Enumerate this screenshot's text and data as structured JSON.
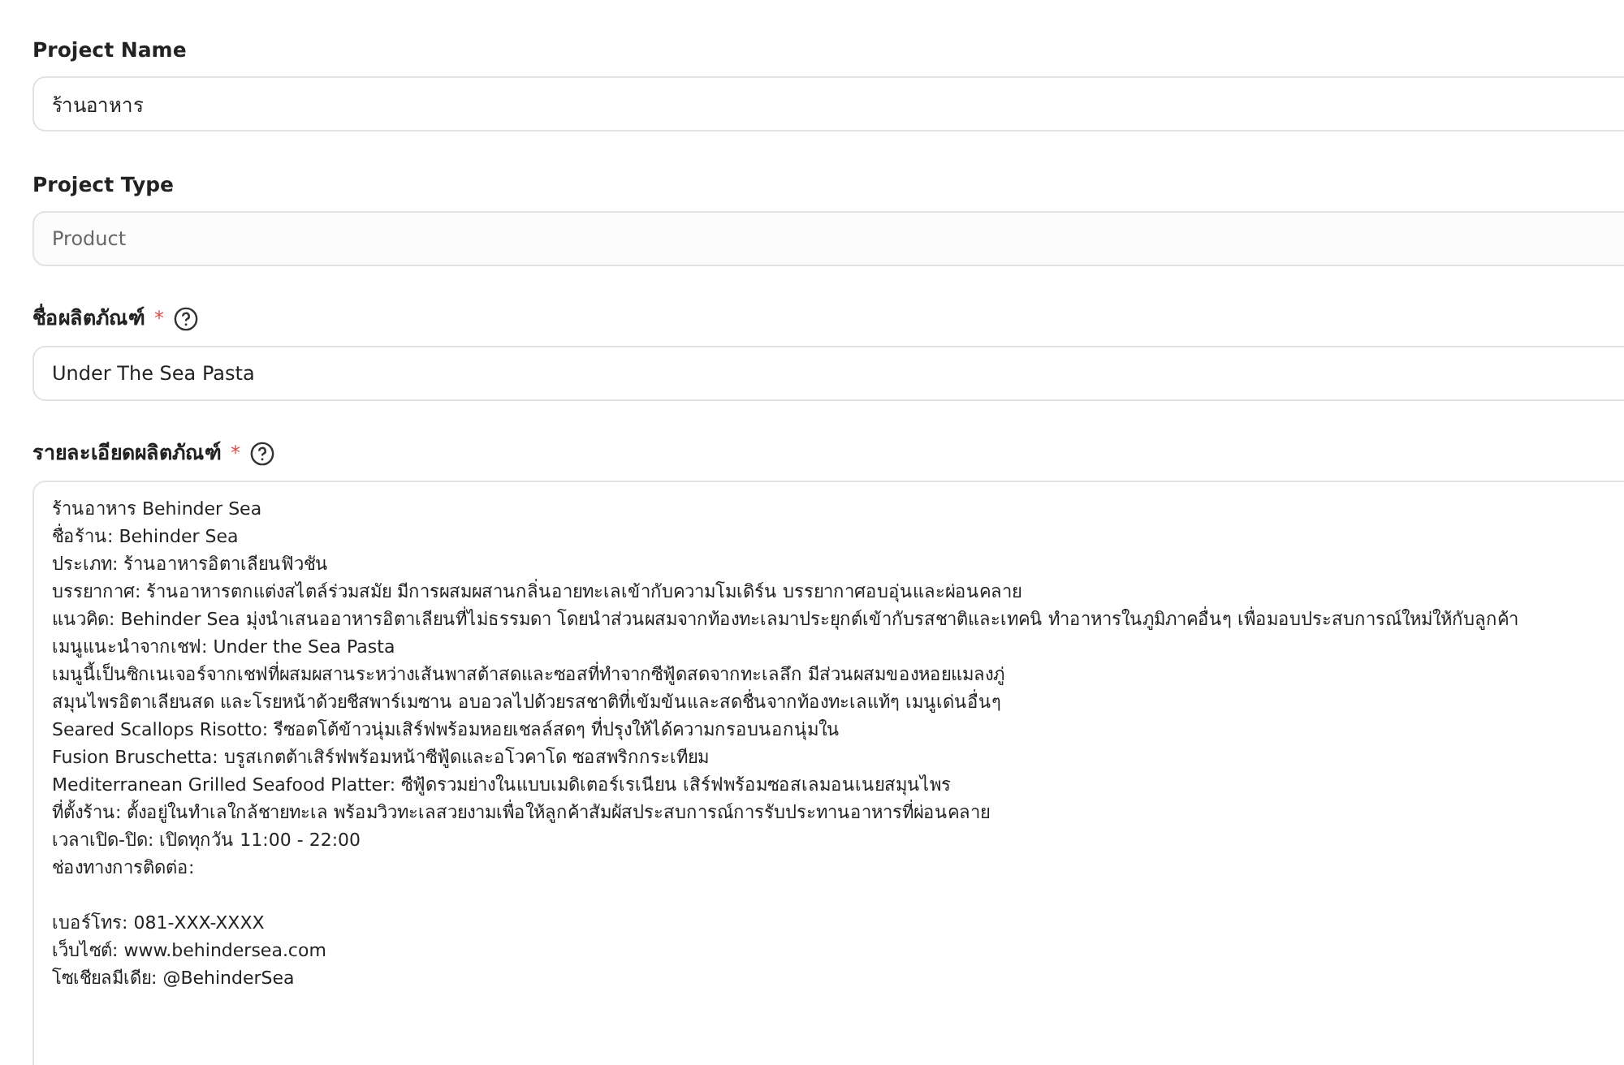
{
  "fields": [
    {
      "kind": "input",
      "label": "Project Name",
      "value": "ร้านอาหาร",
      "readonly": false
    },
    {
      "kind": "input",
      "label": "Project Type",
      "value": "Product",
      "readonly": true
    },
    {
      "kind": "input",
      "label": "ชื่อผลิตภัณฑ์",
      "required_mark": "*",
      "help": true,
      "value": "Under The Sea Pasta",
      "readonly": false
    },
    {
      "kind": "textarea",
      "label": "รายละเอียดผลิตภัณฑ์",
      "required_mark": "*",
      "help": true,
      "paragraphs": [
        [
          "ร้านอาหาร Behinder Sea",
          "ชื่อร้าน: Behinder Sea",
          "ประเภท: ร้านอาหารอิตาเลียนฟิวชัน",
          "บรรยากาศ: ร้านอาหารตกแต่งสไตล์ร่วมสมัย มีการผสมผสานกลิ่นอายทะเลเข้ากับความโมเดิร์น บรรยากาศอบอุ่นและผ่อนคลาย",
          "แนวคิด: Behinder Sea มุ่งนำเสนออาหารอิตาเลียนที่ไม่ธรรมดา โดยนำส่วนผสมจากท้องทะเลมาประยุกต์เข้ากับรสชาติและเทคนิ ทำอาหารในภูมิภาคอื่นๆ เพื่อมอบประสบการณ์ใหม่ให้กับลูกค้า",
          "เมนูแนะนำจากเชฟ: Under the Sea Pasta",
          "เมนูนี้เป็นซิกเนเจอร์จากเชฟที่ผสมผสานระหว่างเส้นพาสต้าสดและซอสที่ทำจากซีฟู้ดสดจากทะเลลึก มีส่วนผสมของหอยแมลงภู่",
          "สมุนไพรอิตาเลียนสด และโรยหน้าด้วยชีสพาร์เมซาน อบอวลไปด้วยรสชาติที่เข้มข้นและสดชื่นจากท้องทะเลแท้ๆ เมนูเด่นอื่นๆ",
          "Seared Scallops Risotto: รีซอตโต้ข้าวนุ่มเสิร์ฟพร้อมหอยเชลล์สดๆ ที่ปรุงให้ได้ความกรอบนอกนุ่มใน",
          "Fusion Bruschetta: บรูสเกตต้าเสิร์ฟพร้อมหน้าซีฟู้ดและอโวคาโด ซอสพริกกระเทียม",
          "Mediterranean Grilled Seafood Platter: ซีฟู้ดรวมย่างในแบบเมดิเตอร์เรเนียน เสิร์ฟพร้อมซอสเลมอนเนยสมุนไพร",
          "ที่ตั้งร้าน: ตั้งอยู่ในทำเลใกล้ชายทะเล พร้อมวิวทะเลสวยงามเพื่อให้ลูกค้าสัมผัสประสบการณ์การรับประทานอาหารที่ผ่อนคลาย",
          "เวลาเปิด-ปิด: เปิดทุกวัน 11:00 - 22:00",
          "ช่องทางการติดต่อ:"
        ],
        [
          "เบอร์โทร: 081-XXX-XXXX",
          "เว็บไซต์: www.behindersea.com",
          "โซเชียลมีเดีย: @BehinderSea"
        ]
      ]
    }
  ]
}
